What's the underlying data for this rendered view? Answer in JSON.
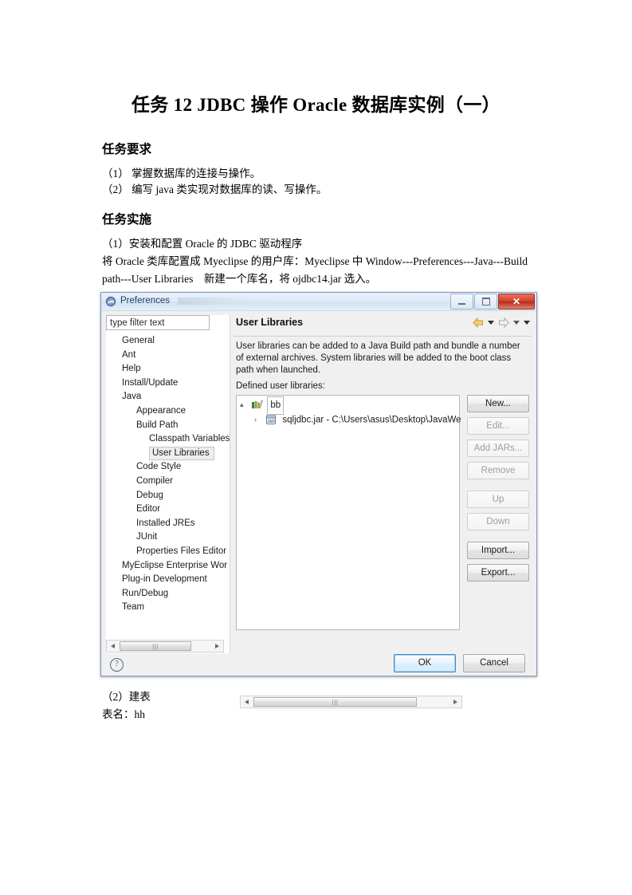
{
  "document": {
    "title": "任务 12    JDBC 操作 Oracle 数据库实例（一）",
    "heading_requirements": "任务要求",
    "req_1": "（1）  掌握数据库的连接与操作。",
    "req_2": "（2）  编写 java 类实现对数据库的读、写操作。",
    "heading_implementation": "任务实施",
    "impl_1": "（1）安装和配置 Oracle 的 JDBC 驱动程序",
    "impl_2": "将 Oracle 类库配置成 Myeclipse 的用户库：Myeclipse 中 Window---Preferences---Java---Build",
    "impl_3": "path---User Libraries　新建一个库名，将 ojdbc14.jar 选入。",
    "after_1": "（2）建表",
    "after_2": "表名：hh"
  },
  "dialog": {
    "title": "Preferences",
    "subtitle_redacted": "",
    "window_buttons": {
      "minimize": "minimize",
      "maximize": "maximize",
      "close": "✕"
    },
    "filter": {
      "placeholder": "type filter text",
      "value": ""
    },
    "tree": [
      {
        "label": "General",
        "level": 1
      },
      {
        "label": "Ant",
        "level": 1
      },
      {
        "label": "Help",
        "level": 1
      },
      {
        "label": "Install/Update",
        "level": 1
      },
      {
        "label": "Java",
        "level": 1
      },
      {
        "label": "Appearance",
        "level": 2
      },
      {
        "label": "Build Path",
        "level": 2
      },
      {
        "label": "Classpath Variables",
        "level": 3
      },
      {
        "label": "User Libraries",
        "level": 3,
        "selected": true
      },
      {
        "label": "Code Style",
        "level": 2
      },
      {
        "label": "Compiler",
        "level": 2
      },
      {
        "label": "Debug",
        "level": 2
      },
      {
        "label": "Editor",
        "level": 2
      },
      {
        "label": "Installed JREs",
        "level": 2
      },
      {
        "label": "JUnit",
        "level": 2
      },
      {
        "label": "Properties Files Editor",
        "level": 2
      },
      {
        "label": "MyEclipse Enterprise Wor",
        "level": 1
      },
      {
        "label": "Plug-in Development",
        "level": 1
      },
      {
        "label": "Run/Debug",
        "level": 1
      },
      {
        "label": "Team",
        "level": 1
      }
    ],
    "page": {
      "title": "User Libraries",
      "description": "User libraries can be added to a Java Build path and bundle a number of external archives. System libraries will be added to the boot class path when launched.",
      "defined_label": "Defined user libraries:",
      "library_tree": [
        {
          "label": "bb",
          "expander": "▴",
          "selected": true,
          "icon": "library-icon"
        },
        {
          "label": "sqljdbc.jar - C:\\Users\\asus\\Desktop\\JavaWe",
          "expander": "›",
          "icon": "jar-icon"
        }
      ],
      "buttons": [
        {
          "label": "New...",
          "enabled": true
        },
        {
          "label": "Edit...",
          "enabled": false
        },
        {
          "label": "Add JARs...",
          "enabled": false
        },
        {
          "label": "Remove",
          "enabled": false
        },
        {
          "label": "Up",
          "enabled": false
        },
        {
          "label": "Down",
          "enabled": false
        },
        {
          "label": "Import...",
          "enabled": true
        },
        {
          "label": "Export...",
          "enabled": true
        }
      ]
    },
    "footer": {
      "help": "?",
      "ok": "OK",
      "cancel": "Cancel"
    },
    "scroll_grip": "|||"
  },
  "colors": {
    "titlebar_blue": "#dfeaf7",
    "close_red": "#d2402c",
    "ok_focus_blue": "#3c8ac9",
    "back_arrow_gold": "#e8b33a"
  }
}
